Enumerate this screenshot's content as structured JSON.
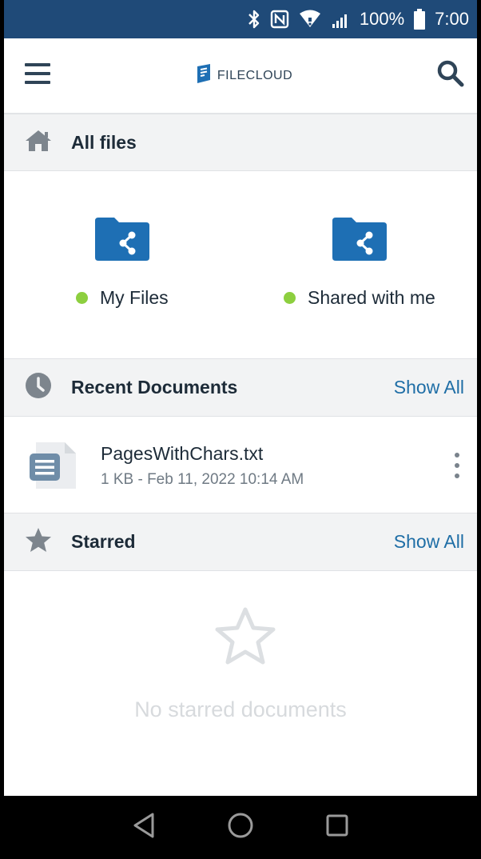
{
  "status_bar": {
    "battery_text": "100%",
    "time": "7:00",
    "icons": [
      "bluetooth-icon",
      "nfc-icon",
      "wifi-icon",
      "signal-icon",
      "battery-icon"
    ]
  },
  "app_bar": {
    "brand": "FILECLOUD",
    "menu_icon": "menu-icon",
    "search_icon": "search-icon"
  },
  "sections": {
    "all_files": {
      "title": "All files",
      "icon": "home-icon"
    },
    "recent": {
      "title": "Recent Documents",
      "show_all": "Show All",
      "icon": "clock-icon"
    },
    "starred": {
      "title": "Starred",
      "show_all": "Show All",
      "icon": "star-icon"
    }
  },
  "quick_access": [
    {
      "label": "My Files",
      "icon": "shared-folder-icon"
    },
    {
      "label": "Shared with me",
      "icon": "shared-folder-icon"
    }
  ],
  "recent_documents": [
    {
      "name": "PagesWithChars.txt",
      "meta": "1 KB - Feb 11, 2022 10:14 AM"
    }
  ],
  "starred_empty_text": "No starred documents",
  "colors": {
    "status_bar": "#1f4a78",
    "accent": "#1f6ea6",
    "folder": "#1e6fb4",
    "online_dot": "#8dcf3f"
  },
  "nav_bar": [
    "back-icon",
    "home-circle-icon",
    "recents-icon"
  ]
}
